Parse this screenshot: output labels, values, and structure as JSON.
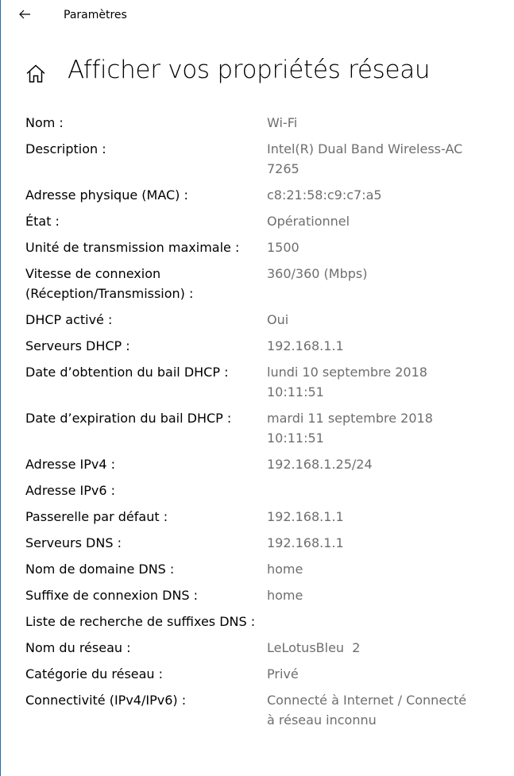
{
  "window": {
    "app_title": "Paramètres"
  },
  "header": {
    "page_title": "Afficher vos propriétés réseau"
  },
  "properties": [
    {
      "label": "Nom :",
      "value": "Wi-Fi"
    },
    {
      "label": "Description :",
      "value": "Intel(R) Dual Band Wireless-AC 7265"
    },
    {
      "label": "Adresse physique (MAC) :",
      "value": "c8:21:58:c9:c7:a5"
    },
    {
      "label": "État :",
      "value": "Opérationnel"
    },
    {
      "label": "Unité de transmission maximale :",
      "value": "1500"
    },
    {
      "label": "Vitesse de connexion (Réception/Transmission) :",
      "value": "360/360 (Mbps)"
    },
    {
      "label": "DHCP activé :",
      "value": "Oui"
    },
    {
      "label": "Serveurs DHCP :",
      "value": "192.168.1.1"
    },
    {
      "label": "Date d’obtention du bail DHCP :",
      "value": "lundi 10 septembre 2018 10:11:51"
    },
    {
      "label": "Date d’expiration du bail DHCP :",
      "value": "mardi 11 septembre 2018 10:11:51"
    },
    {
      "label": "Adresse IPv4 :",
      "value": "192.168.1.25/24"
    },
    {
      "label": "Adresse IPv6 :",
      "value": ""
    },
    {
      "label": "Passerelle par défaut :",
      "value": "192.168.1.1"
    },
    {
      "label": "Serveurs DNS :",
      "value": "192.168.1.1"
    },
    {
      "label": "Nom de domaine DNS :",
      "value": "home"
    },
    {
      "label": "Suffixe de connexion DNS :",
      "value": "home"
    },
    {
      "label": "Liste de recherche de suffixes DNS :",
      "value": ""
    },
    {
      "label": "Nom du réseau :",
      "value": "LeLotusBleu  2"
    },
    {
      "label": "Catégorie du réseau :",
      "value": "Privé"
    },
    {
      "label": "Connectivité (IPv4/IPv6) :",
      "value": "Connecté à Internet / Connecté à réseau inconnu"
    }
  ]
}
